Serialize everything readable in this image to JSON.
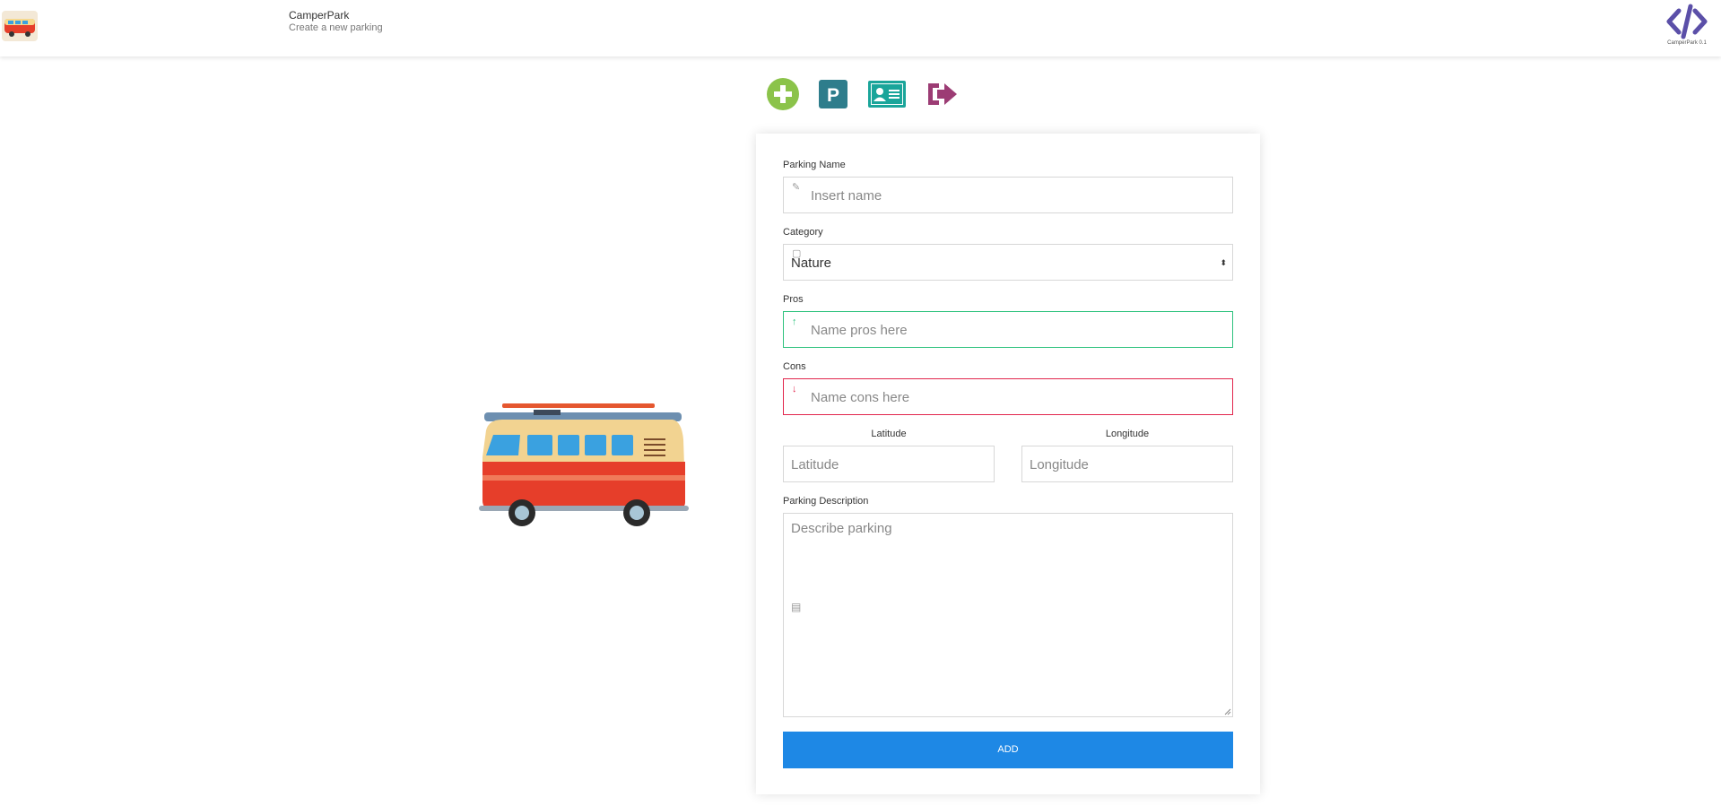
{
  "header": {
    "title": "CamperPark",
    "subtitle": "Create a new parking",
    "version": "CamperPark 0.1"
  },
  "toolbar": {
    "items": [
      {
        "icon": "add-circle-icon",
        "color": "#8bc34a"
      },
      {
        "icon": "parking-icon",
        "color": "#2e7d8c"
      },
      {
        "icon": "id-card-icon",
        "color": "#1aa59a"
      },
      {
        "icon": "logout-icon",
        "color": "#9c3c74"
      }
    ]
  },
  "form": {
    "name": {
      "label": "Parking Name",
      "placeholder": "Insert name"
    },
    "category": {
      "label": "Category",
      "value": "Nature"
    },
    "pros": {
      "label": "Pros",
      "placeholder": "Name pros here"
    },
    "cons": {
      "label": "Cons",
      "placeholder": "Name cons here"
    },
    "latitude": {
      "label": "Latitude",
      "placeholder": "Latitude"
    },
    "longitude": {
      "label": "Longitude",
      "placeholder": "Longitude"
    },
    "description": {
      "label": "Parking Description",
      "placeholder": "Describe parking"
    },
    "submit_label": "ADD"
  },
  "colors": {
    "accent": "#1e88e5",
    "pros_border": "#2ec27e",
    "cons_border": "#e2264d",
    "logo": "#5b4fa8"
  }
}
